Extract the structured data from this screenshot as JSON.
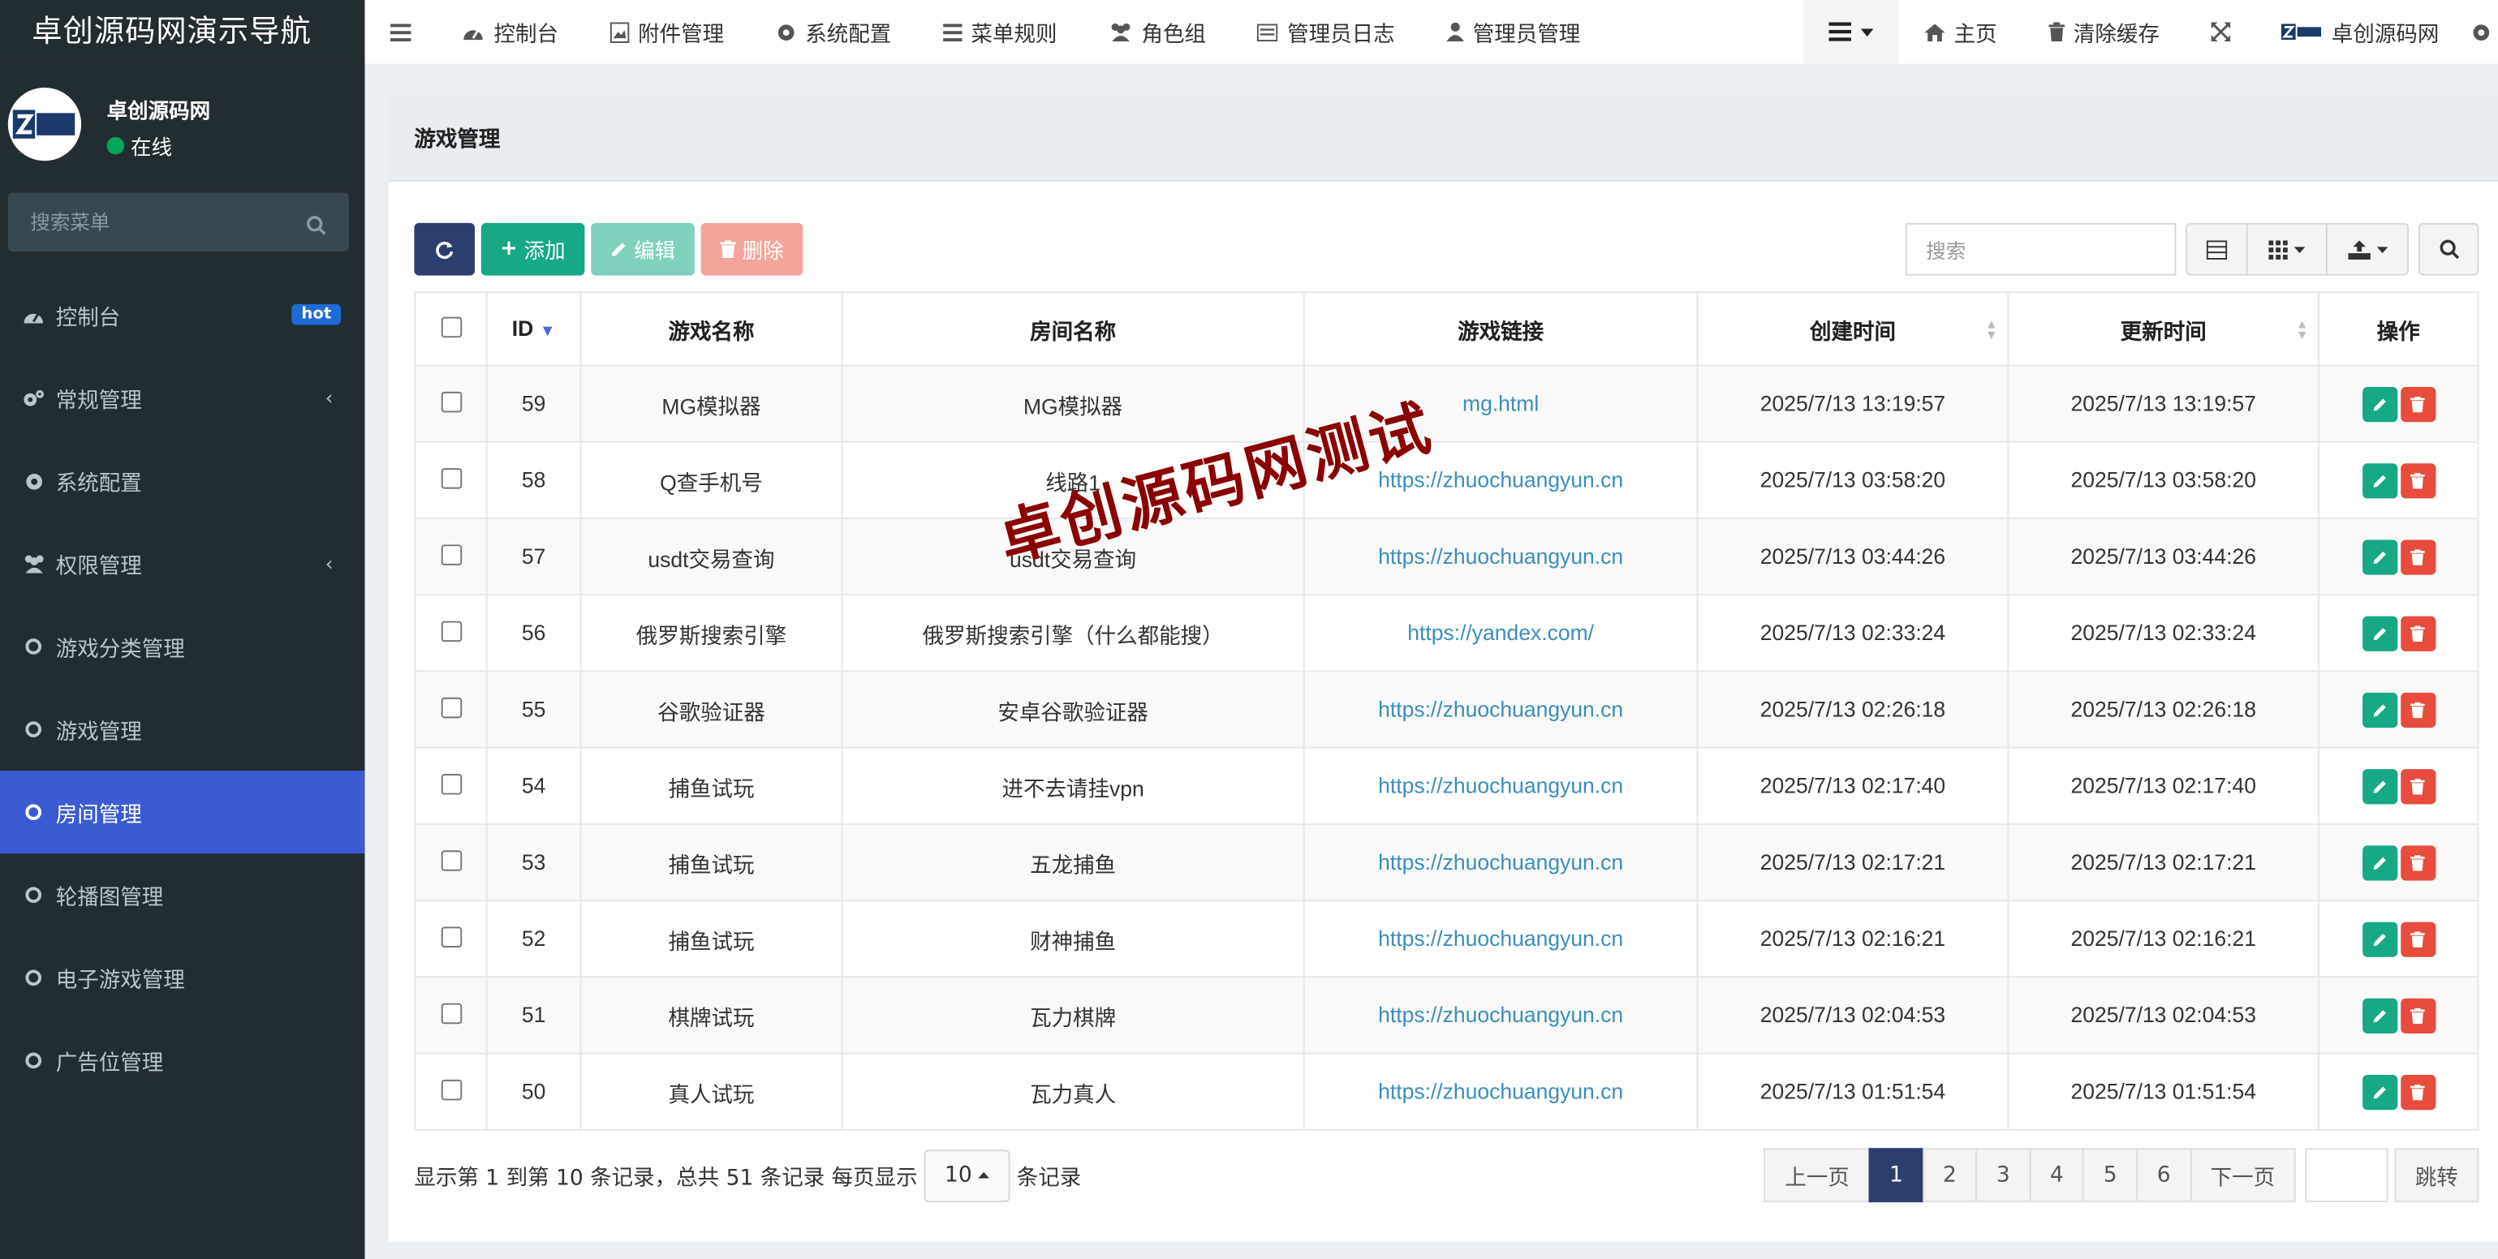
{
  "brand": "卓创源码网演示导航",
  "user": {
    "name": "卓创源码网",
    "status": "在线"
  },
  "sidebar_search_placeholder": "搜索菜单",
  "menu": [
    {
      "label": "控制台",
      "badge": "hot"
    },
    {
      "label": "常规管理"
    },
    {
      "label": "系统配置"
    },
    {
      "label": "权限管理"
    },
    {
      "label": "游戏分类管理"
    },
    {
      "label": "游戏管理"
    },
    {
      "label": "房间管理"
    },
    {
      "label": "轮播图管理"
    },
    {
      "label": "电子游戏管理"
    },
    {
      "label": "广告位管理"
    }
  ],
  "topnav": {
    "items": [
      "控制台",
      "附件管理",
      "系统配置",
      "菜单规则",
      "角色组",
      "管理员日志",
      "管理员管理"
    ],
    "home": "主页",
    "clear_cache": "清除缓存",
    "site": "卓创源码网"
  },
  "panel_title": "游戏管理",
  "toolbar": {
    "add": "添加",
    "edit": "编辑",
    "delete": "删除",
    "search_placeholder": "搜索"
  },
  "table": {
    "headers": [
      "ID",
      "游戏名称",
      "房间名称",
      "游戏链接",
      "创建时间",
      "更新时间",
      "操作"
    ],
    "rows": [
      [
        "59",
        "MG模拟器",
        "MG模拟器",
        "mg.html",
        "2025/7/13 13:19:57",
        "2025/7/13 13:19:57"
      ],
      [
        "58",
        "Q查手机号",
        "线路1",
        "https://zhuochuangyun.cn",
        "2025/7/13 03:58:20",
        "2025/7/13 03:58:20"
      ],
      [
        "57",
        "usdt交易查询",
        "usdt交易查询",
        "https://zhuochuangyun.cn",
        "2025/7/13 03:44:26",
        "2025/7/13 03:44:26"
      ],
      [
        "56",
        "俄罗斯搜索引擎",
        "俄罗斯搜索引擎（什么都能搜）",
        "https://yandex.com/",
        "2025/7/13 02:33:24",
        "2025/7/13 02:33:24"
      ],
      [
        "55",
        "谷歌验证器",
        "安卓谷歌验证器",
        "https://zhuochuangyun.cn",
        "2025/7/13 02:26:18",
        "2025/7/13 02:26:18"
      ],
      [
        "54",
        "捕鱼试玩",
        "进不去请挂vpn",
        "https://zhuochuangyun.cn",
        "2025/7/13 02:17:40",
        "2025/7/13 02:17:40"
      ],
      [
        "53",
        "捕鱼试玩",
        "五龙捕鱼",
        "https://zhuochuangyun.cn",
        "2025/7/13 02:17:21",
        "2025/7/13 02:17:21"
      ],
      [
        "52",
        "捕鱼试玩",
        "财神捕鱼",
        "https://zhuochuangyun.cn",
        "2025/7/13 02:16:21",
        "2025/7/13 02:16:21"
      ],
      [
        "51",
        "棋牌试玩",
        "瓦力棋牌",
        "https://zhuochuangyun.cn",
        "2025/7/13 02:04:53",
        "2025/7/13 02:04:53"
      ],
      [
        "50",
        "真人试玩",
        "瓦力真人",
        "https://zhuochuangyun.cn",
        "2025/7/13 01:51:54",
        "2025/7/13 01:51:54"
      ]
    ]
  },
  "footer": {
    "summary": "显示第 1 到第 10 条记录，总共 51 条记录 每页显示",
    "page_size": "10",
    "suffix": "条记录",
    "prev": "上一页",
    "next": "下一页",
    "pages": [
      "1",
      "2",
      "3",
      "4",
      "5",
      "6"
    ],
    "jump": "跳转"
  },
  "watermark": "卓创源码网测试",
  "colors": {
    "sidebar": "#222d32",
    "active": "#3c5bd3",
    "primary": "#2c3e6e",
    "success": "#17a886",
    "danger": "#e74c3c",
    "link": "#3c8dbc"
  }
}
